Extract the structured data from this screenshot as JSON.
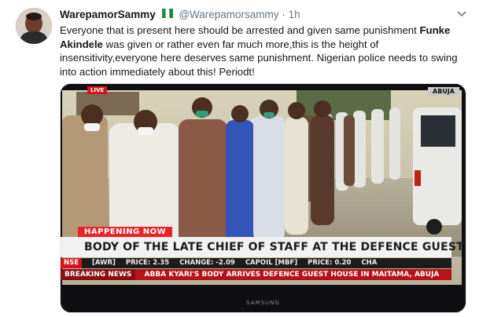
{
  "tweet": {
    "display_name": "WarepamorSammy",
    "handle": "@Warepamorsammy",
    "separator": "·",
    "time": "1h",
    "text_part1": "Everyone that is present here should be arrested and given same punishment",
    "text_bold": "Funke Akindele",
    "text_part2": " was given or rather even far much more,this is the height of insensitivity,everyone here deserves same punishment. Nigerian police needs to swing into action immediately about this! Periodt!"
  },
  "media": {
    "live_badge": "LIVE",
    "location_badge": "ABUJA",
    "happening_label": "HAPPENING NOW",
    "headline": "BODY OF THE LATE CHIEF OF STAFF AT THE DEFENCE GUEST HOUSE",
    "ticker": {
      "nse": "NSE",
      "items": [
        "[AWR]",
        "PRICE: 2.35",
        "CHANGE: -2.09",
        "CAPOIL [MBF]",
        "PRICE: 0.20",
        "CHA"
      ]
    },
    "breaking_label": "BREAKING NEWS",
    "breaking_story": "ABBA KYARI'S BODY ARRIVES DEFENCE GUEST HOUSE IN MAITAMA, ABUJA",
    "tv_brand": "SAMSUNG"
  },
  "icons": {
    "caret": "chevron-down-icon",
    "flag": "nigeria-flag-icon"
  }
}
